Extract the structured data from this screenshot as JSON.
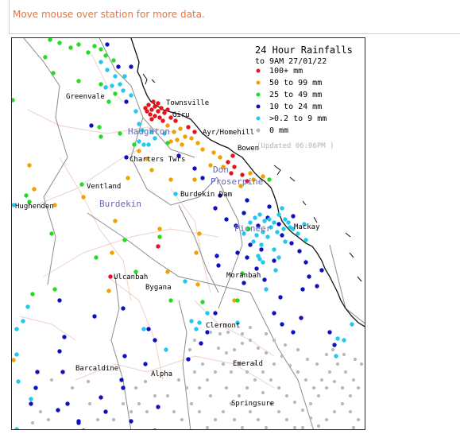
{
  "hint": "Move mouse over station for more data.",
  "legend": {
    "title": "24 Hour Rainfalls",
    "subtitle": "to 9AM 27/01/22",
    "items": [
      {
        "label": "100+ mm",
        "color": "#e8121a"
      },
      {
        "label": "50  to 99 mm",
        "color": "#f2a100"
      },
      {
        "label": "25  to 49 mm",
        "color": "#22dd22"
      },
      {
        "label": "10  to 24 mm",
        "color": "#1010c0"
      },
      {
        "label": ">0.2 to 9 mm",
        "color": "#22c8f0"
      },
      {
        "label": "0 mm",
        "color": "#b8b8b8"
      }
    ],
    "updated": "(Updated 06:06PM  )"
  },
  "towns": {
    "greenvale": "Greenvale",
    "townsville": "Townsville",
    "giru": "Giru",
    "ayr": "Ayr/Homehill",
    "bowen": "Bowen",
    "charters": "Charters Twrs",
    "ventland": "Ventland",
    "burdekin_dam": "Burdekin Dam",
    "hughenden": "Hughenden",
    "mackay": "Mackay",
    "ulcanbah": "Ulcanbah",
    "bygana": "Bygana",
    "moranbah": "Moranbah",
    "clermont": "Clermont",
    "barcaldine": "Barcaldine",
    "alpha": "Alpha",
    "emerald": "Emerald",
    "springsure": "Springsure"
  },
  "basins": {
    "haughton": "Haughton",
    "burdekin": "Burdekin",
    "don": "Don",
    "proserpine": "Proserpine",
    "pioneer": "Pioneer"
  }
}
